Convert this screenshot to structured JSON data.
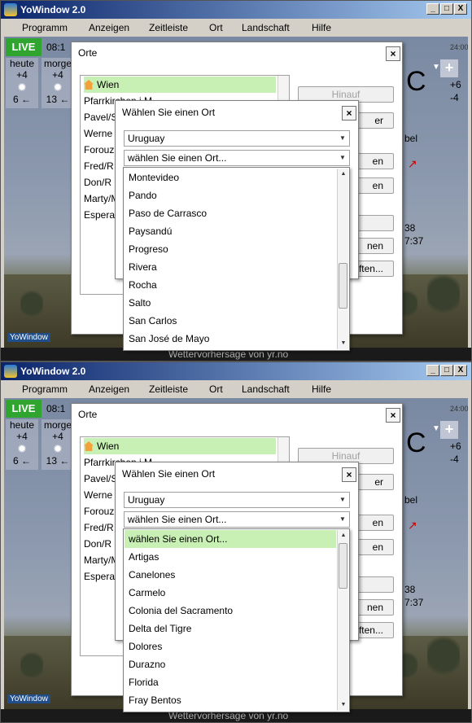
{
  "title": "YoWindow 2.0",
  "window_buttons": [
    "_",
    "□",
    "X"
  ],
  "menu": [
    "Programm",
    "Anzeigen",
    "Zeitleiste",
    "Ort",
    "Landschaft",
    "Hilfe"
  ],
  "weather": {
    "live": "LIVE",
    "time": "08:1",
    "days": [
      {
        "name": "heute",
        "temp_hi": "+4",
        "temp_lo": "6 ←"
      },
      {
        "name": "morge",
        "temp_hi": "+4",
        "temp_lo": "13 ←"
      }
    ],
    "right_time": "24:00",
    "right_temp_hi": "+6",
    "right_temp_lo": "-4",
    "big_unit": "C",
    "nebel": "bel",
    "val1": "38",
    "val2": "7:37",
    "footer": "Wettervorhersage von yr.no",
    "brand": "YoWindow"
  },
  "orte_dialog": {
    "title": "Orte",
    "locations": [
      "Wien",
      "Pfarrkirchen i.M.",
      "Pavel/S",
      "Werne",
      "Forouz",
      "Fred/R",
      "Don/R",
      "Marty/M",
      "Espera"
    ],
    "buttons": [
      "Hinauf",
      "er",
      "en",
      "en",
      "atort",
      "nen",
      "ften..."
    ]
  },
  "select_dialog": {
    "title": "Wählen Sie einen Ort",
    "country": "Uruguay",
    "place_placeholder": "wählen Sie einen Ort..."
  },
  "screens": [
    {
      "places": [
        "Montevideo",
        "Pando",
        "Paso de Carrasco",
        "Paysandú",
        "Progreso",
        "Rivera",
        "Rocha",
        "Salto",
        "San Carlos",
        "San José de Mayo"
      ],
      "highlight": -1
    },
    {
      "places": [
        "wählen Sie einen Ort...",
        "Artigas",
        "Canelones",
        "Carmelo",
        "Colonia del Sacramento",
        "Delta del Tigre",
        "Dolores",
        "Durazno",
        "Florida",
        "Fray Bentos"
      ],
      "highlight": 0
    }
  ]
}
